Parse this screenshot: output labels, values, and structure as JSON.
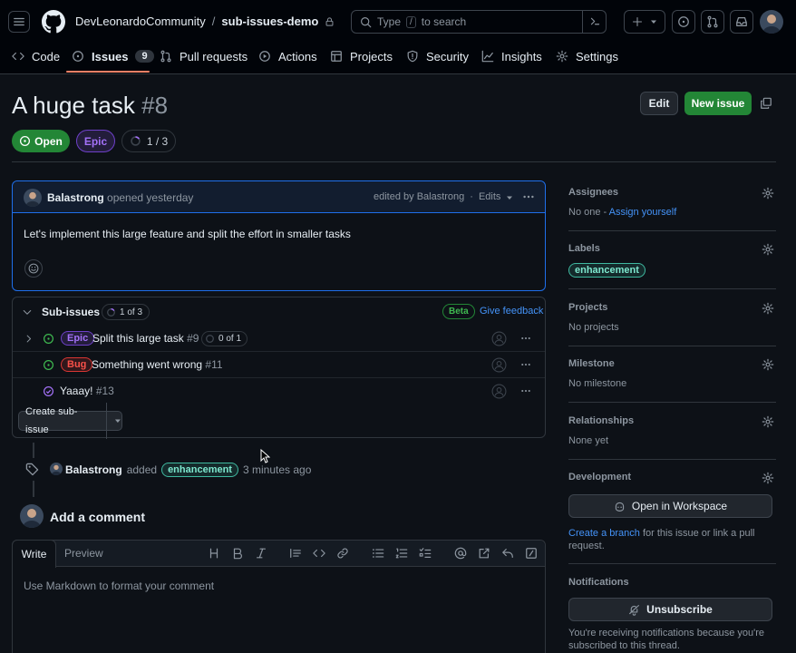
{
  "header": {
    "owner": "DevLeonardoCommunity",
    "separator": "/",
    "repo": "sub-issues-demo",
    "search_prefix": "Type",
    "search_key": "/",
    "search_suffix": "to search"
  },
  "nav": {
    "code": "Code",
    "issues": "Issues",
    "issues_count": "9",
    "pull_requests": "Pull requests",
    "actions": "Actions",
    "projects": "Projects",
    "security": "Security",
    "insights": "Insights",
    "settings": "Settings"
  },
  "issue": {
    "title": "A huge task",
    "number": "#8",
    "state": "Open",
    "type": "Epic",
    "progress": "1 / 3",
    "edit_label": "Edit",
    "new_issue_label": "New issue"
  },
  "comment": {
    "author": "Balastrong",
    "action": "opened yesterday",
    "edited_by": "edited by Balastrong",
    "dot": "·",
    "edits": "Edits",
    "body": "Let's implement this large feature and split the effort in smaller tasks"
  },
  "subissues": {
    "title": "Sub-issues",
    "count": "1 of 3",
    "beta": "Beta",
    "feedback": "Give feedback",
    "items": [
      {
        "type": "Epic",
        "title": "Split this large task",
        "number": "#9",
        "progress": "0 of 1"
      },
      {
        "type": "Bug",
        "title": "Something went wrong",
        "number": "#11"
      },
      {
        "title": "Yaaay!",
        "number": "#13"
      }
    ],
    "create_label": "Create sub-issue"
  },
  "timeline": {
    "author": "Balastrong",
    "action": "added",
    "label": "enhancement",
    "time": "3 minutes ago"
  },
  "add_comment": {
    "title": "Add a comment",
    "tab_write": "Write",
    "tab_preview": "Preview",
    "placeholder": "Use Markdown to format your comment"
  },
  "sidebar": {
    "assignees_h": "Assignees",
    "assignees_none": "No one -",
    "assign_yourself": "Assign yourself",
    "labels_h": "Labels",
    "label": "enhancement",
    "projects_h": "Projects",
    "projects_v": "No projects",
    "milestone_h": "Milestone",
    "milestone_v": "No milestone",
    "relationships_h": "Relationships",
    "relationships_v": "None yet",
    "development_h": "Development",
    "workspace_label": "Open in Workspace",
    "create_branch": "Create a branch",
    "branch_text": "for this issue or link a pull request.",
    "notifications_h": "Notifications",
    "unsubscribe_label": "Unsubscribe",
    "notif_text": "You're receiving notifications because you're subscribed to this thread."
  },
  "colors": {
    "open_green": "#238636",
    "accent_blue": "#4493f8",
    "epic_purple": "#8957e5",
    "bug_red": "#da3633"
  }
}
